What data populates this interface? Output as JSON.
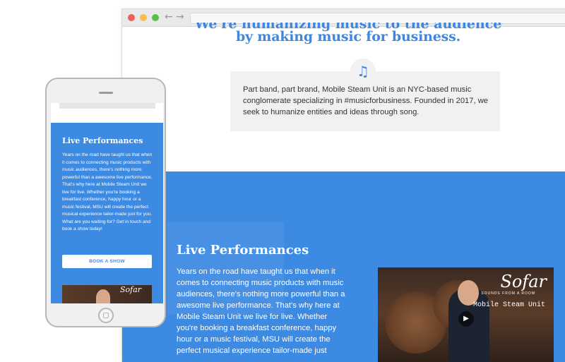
{
  "colors": {
    "accent": "#3d8ae3",
    "card": "#f1f1f1"
  },
  "browser": {
    "nav_back_icon": "←",
    "nav_forward_icon": "→"
  },
  "hero": {
    "tagline_cut": "We're humanizing music to the audience",
    "tagline": "by making music for business."
  },
  "about": {
    "icon": "music-note-icon",
    "icon_glyph": "♫",
    "text": "Part band, part brand, Mobile Steam Unit is an NYC-based music conglomerate specializing in #musicforbusiness. Founded in 2017, we seek to humanize entities and ideas through song."
  },
  "live": {
    "title": "Live Performances",
    "body": "Years on the road have taught us that when it comes to connecting music products with music audiences, there's nothing more powerful than a awesome live performance. That's why here at Mobile Steam Unit we live for live. Whether you're booking a breakfast conference, happy hour or a music festival, MSU will create the perfect musical experience tailor-made just for you. What are you waiting for? Get in touch and book a show today!",
    "desktop_body": "Years on the road have taught us that when it comes to connecting music products with music audiences, there's nothing more powerful than a awesome live performance. That's why here at Mobile Steam Unit we live for live. Whether you're booking a breakfast conference, happy hour or a music festival, MSU will create the perfect musical experience tailor-made just",
    "book_button": "BOOK A SHOW"
  },
  "video": {
    "brand": "Sofar",
    "brand_sub": "SOUNDS FROM A ROOM",
    "caption": "Mobile Steam Unit",
    "play_glyph": "▶"
  }
}
